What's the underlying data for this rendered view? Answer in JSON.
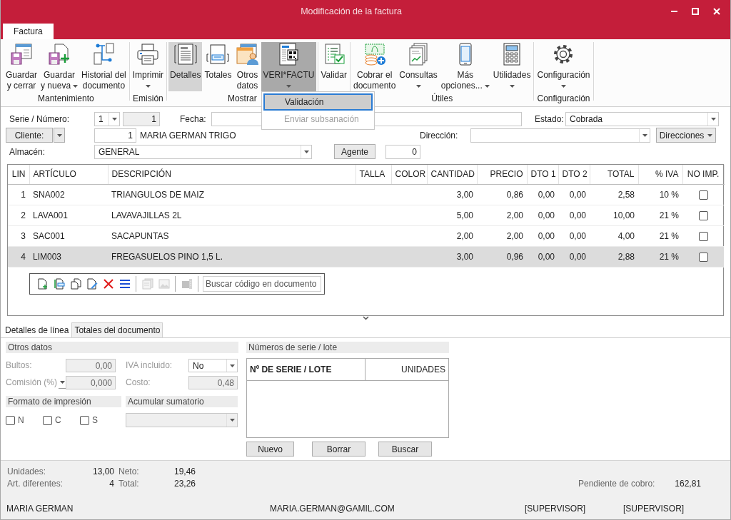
{
  "window": {
    "title": "Modificación de la factura"
  },
  "ribbon_tabs": [
    {
      "label": "Factura",
      "selected": true
    }
  ],
  "ribbon_groups": [
    {
      "label": "Mantenimiento",
      "buttons": [
        {
          "label": "Guardar\ny cerrar",
          "dropdown": false,
          "checked": false,
          "open": false
        },
        {
          "label": "Guardar\ny nueva",
          "dropdown": true,
          "checked": false,
          "open": false
        },
        {
          "label": "Historial del\ndocumento",
          "dropdown": false,
          "checked": false,
          "open": false
        }
      ]
    },
    {
      "label": "Emisión",
      "buttons": [
        {
          "label": "Imprimir",
          "dropdown": true,
          "checked": false,
          "open": false
        }
      ]
    },
    {
      "label": "Mostrar",
      "buttons": [
        {
          "label": "Detalles",
          "dropdown": false,
          "checked": true,
          "open": false
        },
        {
          "label": "Totales",
          "dropdown": false,
          "checked": false,
          "open": false
        },
        {
          "label": "Otros\ndatos",
          "dropdown": false,
          "checked": false,
          "open": false
        },
        {
          "label": "VERI*FACTU",
          "dropdown": true,
          "checked": false,
          "open": true
        }
      ]
    },
    {
      "buttons": [
        {
          "label": "Validar",
          "dropdown": false,
          "checked": false,
          "open": false
        }
      ]
    },
    {
      "label": "Útiles",
      "buttons": [
        {
          "label": "Cobrar el\ndocumento",
          "dropdown": false,
          "checked": false,
          "open": false
        },
        {
          "label": "Consultas",
          "dropdown": true,
          "checked": false,
          "open": false
        },
        {
          "label": "Más\nopciones...",
          "dropdown": true,
          "checked": false,
          "open": false
        },
        {
          "label": "Utilidades",
          "dropdown": true,
          "checked": false,
          "open": false
        }
      ]
    },
    {
      "label": "Configuración",
      "buttons": [
        {
          "label": "Configuración",
          "dropdown": true,
          "checked": false,
          "open": false
        }
      ]
    }
  ],
  "dropdown_menu": {
    "items": [
      {
        "label": "Validación",
        "selected": true,
        "disabled": false
      },
      {
        "label": "Enviar subsanación",
        "selected": false,
        "disabled": true
      }
    ]
  },
  "header_form": {
    "serie_label": "Serie / Número:",
    "serie": "1",
    "numero": "1",
    "fecha_label": "Fecha:",
    "estado_label": "Estado:",
    "estado": "Cobrada",
    "cliente_button": "Cliente:",
    "cliente_code": "1",
    "cliente_name": "MARIA GERMAN TRIGO",
    "direccion_label": "Dirección:",
    "direcciones_button": "Direcciones",
    "almacen_label": "Almacén:",
    "almacen": "GENERAL",
    "agente_button": "Agente",
    "agente": "0"
  },
  "lines_table": {
    "columns": [
      "LIN",
      "ARTÍCULO",
      "DESCRIPCIÓN",
      "TALLA",
      "COLOR",
      "CANTIDAD",
      "PRECIO",
      "DTO 1",
      "DTO 2",
      "TOTAL",
      "% IVA",
      "NO IMP."
    ],
    "rows": [
      {
        "lin": "1",
        "articulo": "SNA002",
        "descripcion": "TRIANGULOS DE MAIZ",
        "cantidad": "3,00",
        "precio": "0,86",
        "dto1": "0,00",
        "dto2": "0,00",
        "total": "2,58",
        "iva": "10 %",
        "no_imp": false,
        "selected": false
      },
      {
        "lin": "2",
        "articulo": "LAVA001",
        "descripcion": "LAVAVAJILLAS 2L",
        "cantidad": "5,00",
        "precio": "2,00",
        "dto1": "0,00",
        "dto2": "0,00",
        "total": "10,00",
        "iva": "21 %",
        "no_imp": false,
        "selected": false
      },
      {
        "lin": "3",
        "articulo": "SAC001",
        "descripcion": "SACAPUNTAS",
        "cantidad": "2,00",
        "precio": "2,00",
        "dto1": "0,00",
        "dto2": "0,00",
        "total": "4,00",
        "iva": "21 %",
        "no_imp": false,
        "selected": false
      },
      {
        "lin": "4",
        "articulo": "LIM003",
        "descripcion": "FREGASUELOS PINO 1,5 L.",
        "cantidad": "3,00",
        "precio": "0,96",
        "dto1": "0,00",
        "dto2": "0,00",
        "total": "2,88",
        "iva": "21 %",
        "no_imp": false,
        "selected": true
      }
    ]
  },
  "table_toolbar": {
    "tools": [
      {
        "disabled": false
      },
      {
        "disabled": false
      },
      {
        "disabled": false
      },
      {
        "disabled": false
      },
      {
        "disabled": false
      },
      {
        "disabled": false
      },
      {
        "disabled": true
      },
      {
        "disabled": true
      },
      {
        "disabled": true
      }
    ],
    "search_placeholder": "Buscar código en documento"
  },
  "detail_tabs": [
    {
      "label": "Detalles de línea",
      "selected": true
    },
    {
      "label": "Totales del documento",
      "selected": false
    }
  ],
  "otros_datos": {
    "title": "Otros datos",
    "bultos_label": "Bultos:",
    "bultos": "0,00",
    "comision_label": "Comisión (%)",
    "comision": "0,000",
    "iva_incluido_label": "IVA incluido:",
    "iva_incluido": "No",
    "costo_label": "Costo:",
    "costo": "0,48"
  },
  "formato_impresion": {
    "title": "Formato de impresión",
    "options": [
      {
        "label": "N",
        "checked": false
      },
      {
        "label": "C",
        "checked": false
      },
      {
        "label": "S",
        "checked": false
      }
    ]
  },
  "acumular_sumatorio": {
    "title": "Acumular sumatorio"
  },
  "serie_lote": {
    "title": "Números de serie / lote",
    "columns": [
      "Nº DE SERIE / LOTE",
      "UNIDADES"
    ],
    "buttons": [
      "Nuevo",
      "Borrar",
      "Buscar"
    ]
  },
  "totals": {
    "unidades_label": "Unidades:",
    "unidades": "13,00",
    "neto_label": "Neto:",
    "neto": "19,46",
    "art_label": "Art. diferentes:",
    "art": "4",
    "total_label": "Total:",
    "total": "23,26",
    "pendiente_label": "Pendiente de cobro:",
    "pendiente": "162,81"
  },
  "status_bar": [
    "MARIA GERMAN",
    "MARIA.GERMAN@GAMIL.COM",
    "[SUPERVISOR]",
    "[SUPERVISOR]"
  ]
}
